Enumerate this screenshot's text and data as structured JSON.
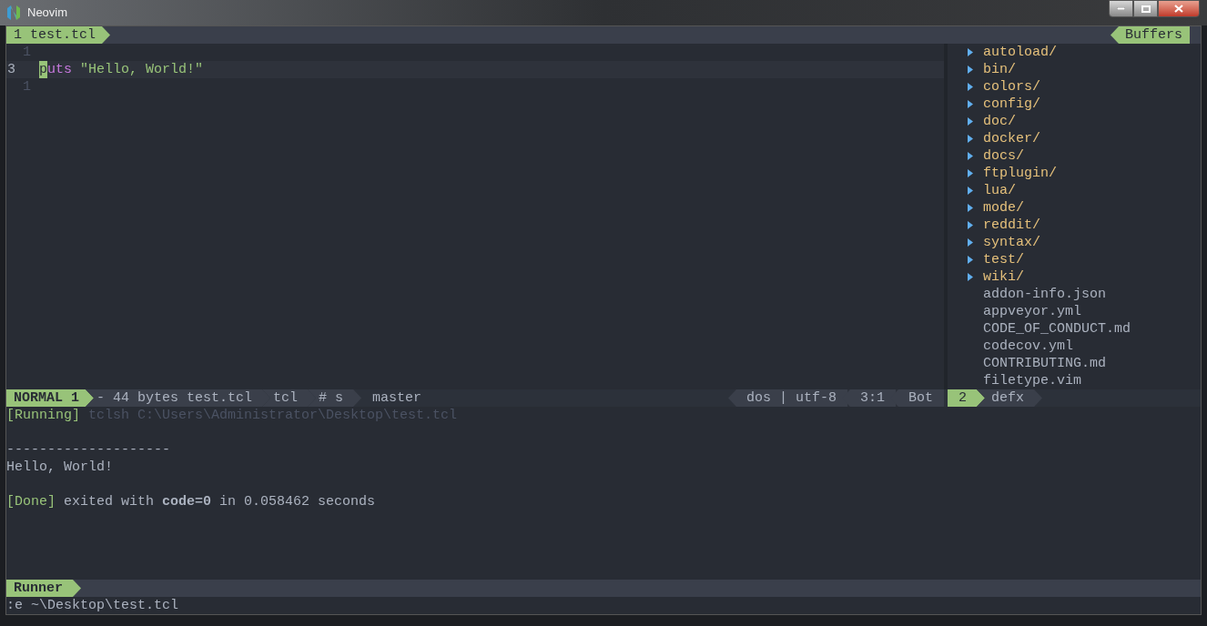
{
  "window": {
    "title": "Neovim"
  },
  "tabline": {
    "buffer_tab": "1 test.tcl",
    "right_label": "Buffers"
  },
  "editor": {
    "lines": [
      {
        "number": "1",
        "current": false
      },
      {
        "number": "3",
        "current": true,
        "segments": [
          {
            "text": "p",
            "kind": "cursor"
          },
          {
            "text": "uts",
            "kind": "keyword"
          },
          {
            "text": "\"Hello, World!\"",
            "kind": "string"
          }
        ]
      },
      {
        "number": "1",
        "current": false
      }
    ]
  },
  "tree": {
    "items": [
      {
        "name": "autoload/",
        "kind": "dir"
      },
      {
        "name": "bin/",
        "kind": "dir"
      },
      {
        "name": "colors/",
        "kind": "dir"
      },
      {
        "name": "config/",
        "kind": "dir"
      },
      {
        "name": "doc/",
        "kind": "dir"
      },
      {
        "name": "docker/",
        "kind": "dir"
      },
      {
        "name": "docs/",
        "kind": "dir"
      },
      {
        "name": "ftplugin/",
        "kind": "dir"
      },
      {
        "name": "lua/",
        "kind": "dir"
      },
      {
        "name": "mode/",
        "kind": "dir"
      },
      {
        "name": "reddit/",
        "kind": "dir"
      },
      {
        "name": "syntax/",
        "kind": "dir"
      },
      {
        "name": "test/",
        "kind": "dir"
      },
      {
        "name": "wiki/",
        "kind": "dir"
      },
      {
        "name": "addon-info.json",
        "kind": "file"
      },
      {
        "name": "appveyor.yml",
        "kind": "file"
      },
      {
        "name": "CODE_OF_CONDUCT.md",
        "kind": "file"
      },
      {
        "name": "codecov.yml",
        "kind": "file"
      },
      {
        "name": "CONTRIBUTING.md",
        "kind": "file"
      },
      {
        "name": "filetype.vim",
        "kind": "file"
      }
    ]
  },
  "statusline": {
    "left": [
      {
        "text": "NORMAL 1",
        "kind": "mode"
      },
      {
        "text": "- 44 bytes test.tcl",
        "kind": "segment"
      },
      {
        "text": "tcl",
        "kind": "segment"
      },
      {
        "text": "# s",
        "kind": "segment"
      },
      {
        "text": "master",
        "kind": "plain"
      }
    ],
    "right": [
      "dos | utf-8",
      "3:1",
      "Bot"
    ],
    "tree_number": "2",
    "tree_name": "defx"
  },
  "runner": {
    "output": [
      {
        "kind": "line",
        "tag": "[Running]",
        "text": "tclsh C:\\Users\\Administrator\\Desktop\\test.tcl",
        "dim": true
      },
      {
        "kind": "blank"
      },
      {
        "kind": "line",
        "text": "--------------------",
        "dim": false
      },
      {
        "kind": "line",
        "text": "Hello, World!",
        "dim": false
      },
      {
        "kind": "blank"
      },
      {
        "kind": "line",
        "tag": "[Done]",
        "text": "exited with **code=0** in 0.058462 seconds",
        "dim": false
      }
    ],
    "status": "Runner"
  },
  "cmdline": ":e ~\\Desktop\\test.tcl"
}
